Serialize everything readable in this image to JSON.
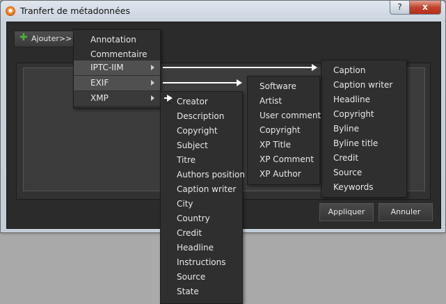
{
  "window": {
    "title": "Tranfert de métadonnées",
    "help_label": "?",
    "close_label": "x"
  },
  "toolbar": {
    "add_label": "Ajouter>>"
  },
  "buttons": {
    "apply_label": "Appliquer",
    "cancel_label": "Annuler"
  },
  "main_menu": {
    "items": [
      {
        "label": "Annotation"
      },
      {
        "label": "Commentaire"
      },
      {
        "label": "IPTC-IIM",
        "has_submenu": true
      },
      {
        "label": "EXIF",
        "has_submenu": true
      },
      {
        "label": "XMP",
        "has_submenu": true
      }
    ]
  },
  "iptc_menu": {
    "items": [
      "Caption",
      "Caption writer",
      "Headline",
      "Copyright",
      "Byline",
      "Byline title",
      "Credit",
      "Source",
      "Keywords"
    ]
  },
  "exif_menu": {
    "items": [
      "Software",
      "Artist",
      "User comment",
      "Copyright",
      "XP Title",
      "XP Comment",
      "XP Author"
    ]
  },
  "xmp_menu": {
    "items": [
      "Creator",
      "Description",
      "Copyright",
      "Subject",
      "Titre",
      "Authors position",
      "Caption writer",
      "City",
      "Country",
      "Credit",
      "Headline",
      "Instructions",
      "Source",
      "State"
    ]
  }
}
